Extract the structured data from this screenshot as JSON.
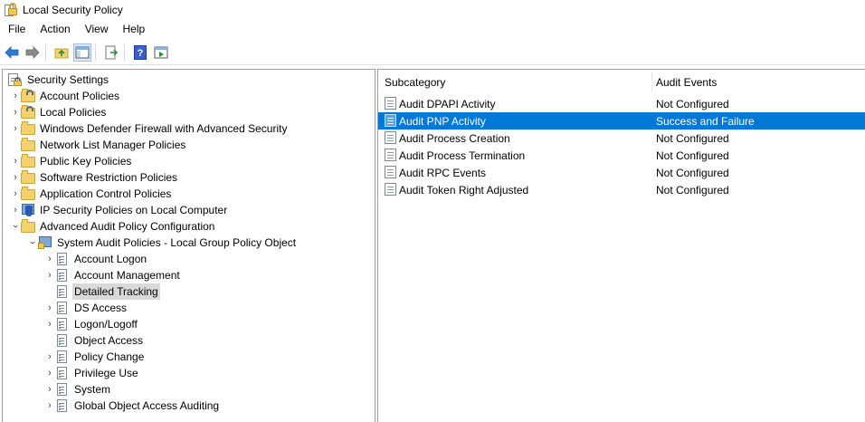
{
  "window": {
    "title": "Local Security Policy"
  },
  "menu": [
    "File",
    "Action",
    "View",
    "Help"
  ],
  "toolbar": {
    "icons": [
      "back-arrow-icon",
      "forward-arrow-icon",
      "up-folder-icon",
      "show-hide-tree-icon",
      "export-list-icon",
      "help-icon",
      "properties-icon"
    ]
  },
  "tree": {
    "root": "Security Settings",
    "items": [
      {
        "label": "Account Policies"
      },
      {
        "label": "Local Policies"
      },
      {
        "label": "Windows Defender Firewall with Advanced Security"
      },
      {
        "label": "Network List Manager Policies"
      },
      {
        "label": "Public Key Policies"
      },
      {
        "label": "Software Restriction Policies"
      },
      {
        "label": "Application Control Policies"
      },
      {
        "label": "IP Security Policies on Local Computer"
      },
      {
        "label": "Advanced Audit Policy Configuration"
      }
    ],
    "sub_root": "System Audit Policies - Local Group Policy Object",
    "categories": [
      {
        "label": "Account Logon"
      },
      {
        "label": "Account Management"
      },
      {
        "label": "Detailed Tracking"
      },
      {
        "label": "DS Access"
      },
      {
        "label": "Logon/Logoff"
      },
      {
        "label": "Object Access"
      },
      {
        "label": "Policy Change"
      },
      {
        "label": "Privilege Use"
      },
      {
        "label": "System"
      },
      {
        "label": "Global Object Access Auditing"
      }
    ],
    "selected": "Detailed Tracking"
  },
  "list": {
    "columns": [
      "Subcategory",
      "Audit Events"
    ],
    "rows": [
      {
        "subcategory": "Audit DPAPI Activity",
        "events": "Not Configured"
      },
      {
        "subcategory": "Audit PNP Activity",
        "events": "Success and Failure"
      },
      {
        "subcategory": "Audit Process Creation",
        "events": "Not Configured"
      },
      {
        "subcategory": "Audit Process Termination",
        "events": "Not Configured"
      },
      {
        "subcategory": "Audit RPC Events",
        "events": "Not Configured"
      },
      {
        "subcategory": "Audit Token Right Adjusted",
        "events": "Not Configured"
      }
    ],
    "selected_row": "Audit PNP Activity"
  },
  "colors": {
    "selection": "#0078d7",
    "tree_selection": "#d9d9d9"
  }
}
